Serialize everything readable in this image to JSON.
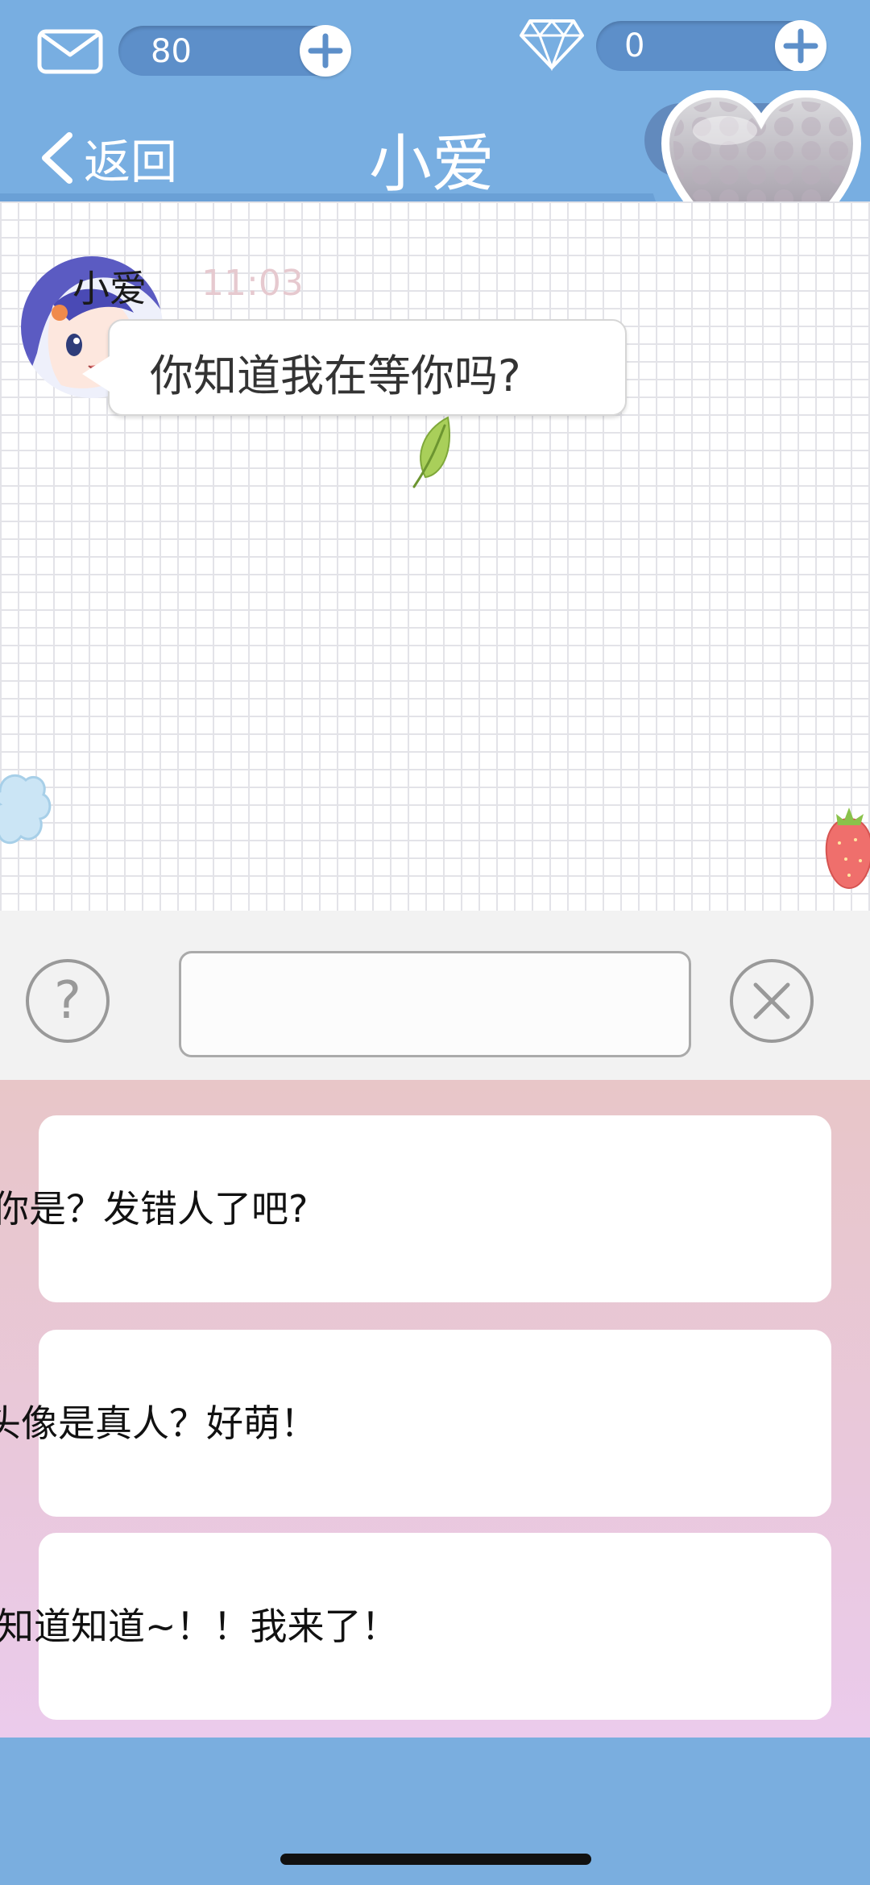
{
  "header": {
    "mail_count": "80",
    "gem_count": "0",
    "back_label": "返回",
    "title": "小爱"
  },
  "chat": {
    "sender_name": "小爱",
    "time": "11:03",
    "message": "你知道我在等你吗?"
  },
  "input": {
    "placeholder": "",
    "value": ""
  },
  "options": [
    {
      "text": "你是？发错人了吧?"
    },
    {
      "text": "头像是真人？好萌！"
    },
    {
      "text": "知道知道~！！我来了！"
    }
  ],
  "colors": {
    "accent_blue": "#78aee1",
    "option_bg_top": "#e8c6c8",
    "option_bg_bottom": "#ebcbec"
  },
  "icons": {
    "mail": "mail-icon",
    "gem": "diamond-icon",
    "plus": "plus-icon",
    "back": "chevron-left-icon",
    "help": "question-icon",
    "close": "close-icon",
    "heart": "heart-icon"
  }
}
